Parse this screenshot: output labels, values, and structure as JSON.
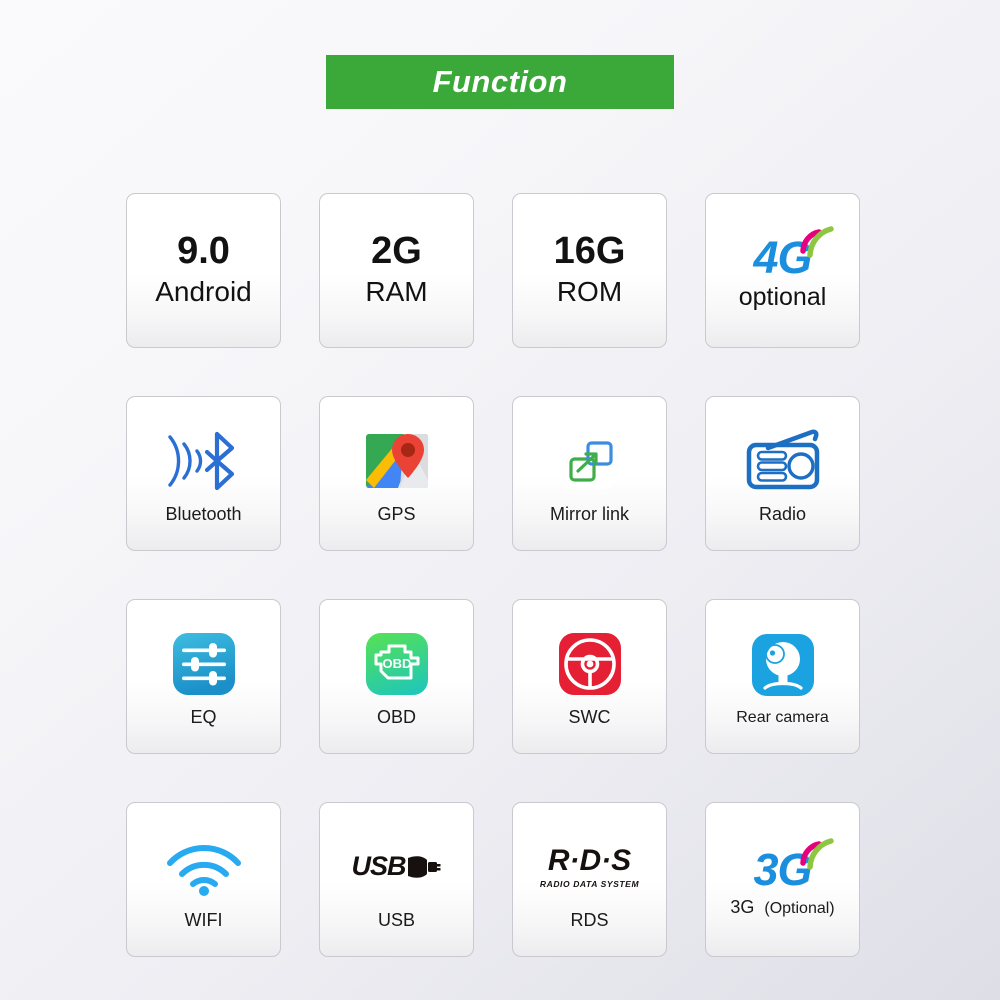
{
  "header": {
    "title": "Function",
    "banner_color": "#3aa93a"
  },
  "colors": {
    "accent_green": "#3aa93a",
    "brand_blue": "#1b8ede",
    "wifi_blue": "#28aaf0",
    "bluetooth_blue": "#2b6fd4",
    "radio_blue": "#1d6fc4",
    "eq_blue": "#27a6d9",
    "obd_green": "#4cd964",
    "swc_red": "#e51f34",
    "camera_blue": "#1aa3e0",
    "arc_pink": "#e6007e",
    "arc_green": "#8dc63f",
    "text_dark": "#121212"
  },
  "grid": {
    "columns": 4,
    "rows": 4,
    "cards": [
      {
        "id": "android",
        "kind": "spec",
        "big": "9.0",
        "sub": "Android"
      },
      {
        "id": "ram",
        "kind": "spec",
        "big": "2G",
        "sub": "RAM"
      },
      {
        "id": "rom",
        "kind": "spec",
        "big": "16G",
        "sub": "ROM"
      },
      {
        "id": "4g",
        "kind": "gen",
        "logo": "4G",
        "word": "optional",
        "icon": "4g-signal-icon"
      },
      {
        "id": "bluetooth",
        "kind": "icon",
        "label": "Bluetooth",
        "icon": "bluetooth-icon"
      },
      {
        "id": "gps",
        "kind": "icon",
        "label": "GPS",
        "icon": "gps-map-pin-icon"
      },
      {
        "id": "mirrorlink",
        "kind": "icon",
        "label": "Mirror link",
        "icon": "mirror-link-icon"
      },
      {
        "id": "radio",
        "kind": "icon",
        "label": "Radio",
        "icon": "radio-icon"
      },
      {
        "id": "eq",
        "kind": "icon",
        "label": "EQ",
        "icon": "equalizer-sliders-icon"
      },
      {
        "id": "obd",
        "kind": "icon",
        "label": "OBD",
        "icon": "obd-engine-icon",
        "glyph_text": "OBD"
      },
      {
        "id": "swc",
        "kind": "icon",
        "label": "SWC",
        "icon": "steering-wheel-icon"
      },
      {
        "id": "rearcamera",
        "kind": "icon",
        "label": "Rear camera",
        "icon": "rear-camera-icon"
      },
      {
        "id": "wifi",
        "kind": "icon",
        "label": "WIFI",
        "icon": "wifi-icon"
      },
      {
        "id": "usb",
        "kind": "mark",
        "label": "USB",
        "mark_text": "USB",
        "icon": "usb-plug-icon"
      },
      {
        "id": "rds",
        "kind": "mark",
        "label": "RDS",
        "mark_text": "R·D·S",
        "mark_sub": "RADIO DATA SYSTEM",
        "icon": "rds-wordmark-icon"
      },
      {
        "id": "3g",
        "kind": "gen",
        "logo": "3G",
        "label": "3G",
        "optional_note": "(Optional)",
        "icon": "3g-signal-icon"
      }
    ]
  }
}
